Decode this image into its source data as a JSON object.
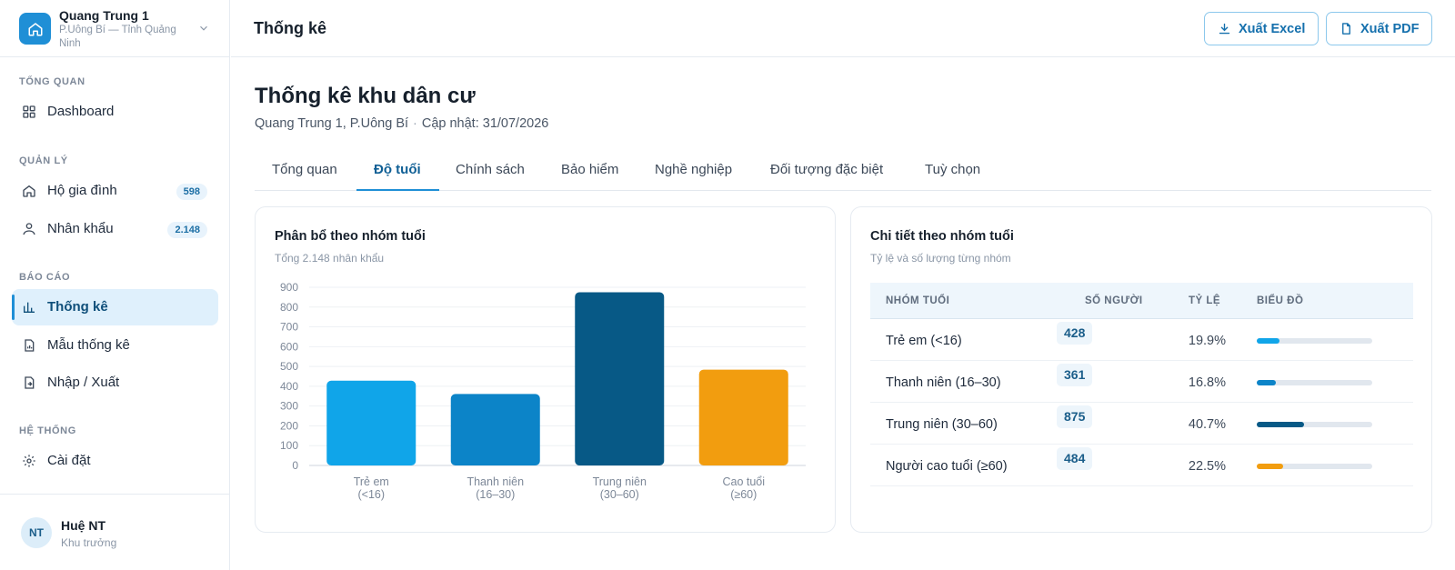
{
  "org": {
    "name": "Quang Trung 1",
    "subtitle": "P.Uông Bí — Tỉnh Quảng Ninh"
  },
  "sidebar": {
    "sections": [
      {
        "label": "TỔNG QUAN",
        "items": [
          {
            "label": "Dashboard",
            "icon": "grid-icon"
          }
        ]
      },
      {
        "label": "QUẢN LÝ",
        "items": [
          {
            "label": "Hộ gia đình",
            "icon": "home-icon",
            "badge": "598"
          },
          {
            "label": "Nhân khẩu",
            "icon": "person-icon",
            "badge": "2.148"
          }
        ]
      },
      {
        "label": "BÁO CÁO",
        "items": [
          {
            "label": "Thống kê",
            "icon": "bar-chart-icon",
            "active": true
          },
          {
            "label": "Mẫu thống kê",
            "icon": "document-chart-icon"
          },
          {
            "label": "Nhập / Xuất",
            "icon": "file-transfer-icon"
          }
        ]
      },
      {
        "label": "HỆ THỐNG",
        "items": [
          {
            "label": "Cài đặt",
            "icon": "gear-icon"
          }
        ]
      }
    ]
  },
  "user": {
    "initials": "NT",
    "name": "Huệ NT",
    "role": "Khu trưởng"
  },
  "header": {
    "title": "Thống kê",
    "export_excel": "Xuất Excel",
    "export_pdf": "Xuất PDF"
  },
  "page": {
    "title": "Thống kê khu dân cư",
    "location": "Quang Trung 1, P.Uông Bí",
    "updated": "Cập nhật: 31/07/2026"
  },
  "tabs": [
    {
      "label": "Tổng quan"
    },
    {
      "label": "Độ tuổi",
      "active": true
    },
    {
      "label": "Chính sách"
    },
    {
      "label": "Bảo hiểm"
    },
    {
      "label": "Nghề nghiệp"
    },
    {
      "label": "Đối tượng đặc biệt"
    },
    {
      "label": "Tuỳ chọn"
    }
  ],
  "chart_card": {
    "title": "Phân bổ theo nhóm tuổi",
    "subtitle": "Tổng 2.148 nhân khẩu"
  },
  "chart_data": {
    "type": "bar",
    "categories": [
      [
        "Trẻ em",
        "(<16)"
      ],
      [
        "Thanh niên",
        "(16–30)"
      ],
      [
        "Trung niên",
        "(30–60)"
      ],
      [
        "Cao tuổi",
        "(≥60)"
      ]
    ],
    "values": [
      428,
      361,
      875,
      484
    ],
    "colors": [
      "#10a5e9",
      "#0c84c8",
      "#075986",
      "#f29d0f"
    ],
    "ylim": [
      0,
      900
    ],
    "yticks": [
      "0",
      "100",
      "200",
      "300",
      "400",
      "500",
      "600",
      "700",
      "800",
      "900"
    ],
    "grid": true
  },
  "detail_card": {
    "title": "Chi tiết theo nhóm tuổi",
    "subtitle": "Tỷ lệ và số lượng từng nhóm",
    "columns": [
      "NHÓM TUỔI",
      "SỐ NGƯỜI",
      "TỶ LỆ",
      "BIỂU ĐỒ"
    ],
    "rows": [
      {
        "group": "Trẻ em (<16)",
        "count": "428",
        "percent": "19.9%",
        "fraction": 0.199,
        "color": "#10a5e9"
      },
      {
        "group": "Thanh niên (16–30)",
        "count": "361",
        "percent": "16.8%",
        "fraction": 0.168,
        "color": "#0c84c8"
      },
      {
        "group": "Trung niên (30–60)",
        "count": "875",
        "percent": "40.7%",
        "fraction": 0.407,
        "color": "#075986"
      },
      {
        "group": "Người cao tuổi (≥60)",
        "count": "484",
        "percent": "22.5%",
        "fraction": 0.225,
        "color": "#f29d0f"
      }
    ]
  }
}
